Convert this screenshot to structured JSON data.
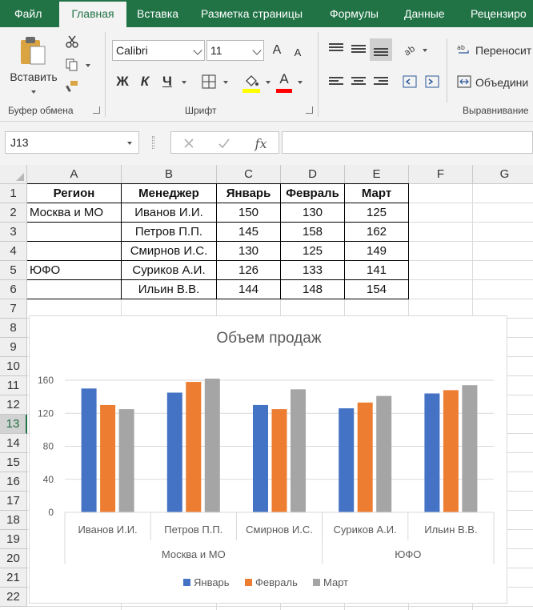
{
  "ribbon": {
    "tabs": [
      "Файл",
      "Главная",
      "Вставка",
      "Разметка страницы",
      "Формулы",
      "Данные",
      "Рецензиро"
    ],
    "active_tab": "Главная",
    "clipboard": {
      "paste_label": "Вставить",
      "group_label": "Буфер обмена"
    },
    "font": {
      "name": "Calibri",
      "size": "11",
      "bold": "Ж",
      "italic": "К",
      "underline": "Ч",
      "grow": "A",
      "shrink": "A",
      "font_color_letter": "A",
      "group_label": "Шрифт"
    },
    "alignment": {
      "wrap_label": "Переносит",
      "merge_label": "Объедини",
      "group_label": "Выравнивание"
    },
    "colors": {
      "fill_color": "#FFFF00",
      "font_color": "#FF0000"
    }
  },
  "formula_bar": {
    "name_box": "J13",
    "fx": "fx",
    "formula": ""
  },
  "sheet": {
    "columns": [
      "A",
      "B",
      "C",
      "D",
      "E",
      "F",
      "G"
    ],
    "rows": [
      "1",
      "2",
      "3",
      "4",
      "5",
      "6",
      "7",
      "8",
      "9",
      "10",
      "11",
      "12",
      "13",
      "14",
      "15",
      "16",
      "17",
      "18",
      "19",
      "20",
      "21",
      "22"
    ],
    "selected_row": "13",
    "header": [
      "Регион",
      "Менеджер",
      "Январь",
      "Февраль",
      "Март"
    ],
    "data": [
      [
        "Москва и МО",
        "Иванов И.И.",
        "150",
        "130",
        "125"
      ],
      [
        "",
        "Петров П.П.",
        "145",
        "158",
        "162"
      ],
      [
        "",
        "Смирнов И.С.",
        "130",
        "125",
        "149"
      ],
      [
        "ЮФО",
        "Суриков А.И.",
        "126",
        "133",
        "141"
      ],
      [
        "",
        "Ильин В.В.",
        "144",
        "148",
        "154"
      ]
    ]
  },
  "chart_data": {
    "type": "bar",
    "title": "Объем продаж",
    "categories": [
      "Иванов И.И.",
      "Петров П.П.",
      "Смирнов И.С.",
      "Суриков А.И.",
      "Ильин В.В."
    ],
    "groups": [
      {
        "label": "Москва и МО",
        "categories": [
          "Иванов И.И.",
          "Петров П.П.",
          "Смирнов И.С."
        ]
      },
      {
        "label": "ЮФО",
        "categories": [
          "Суриков А.И.",
          "Ильин В.В."
        ]
      }
    ],
    "series": [
      {
        "name": "Январь",
        "values": [
          150,
          145,
          130,
          126,
          144
        ],
        "color": "#4472C4"
      },
      {
        "name": "Февраль",
        "values": [
          130,
          158,
          125,
          133,
          148
        ],
        "color": "#ED7D31"
      },
      {
        "name": "Март",
        "values": [
          125,
          162,
          149,
          141,
          154
        ],
        "color": "#A5A5A5"
      }
    ],
    "yticks": [
      "0",
      "40",
      "80",
      "120",
      "160"
    ],
    "ylim": [
      0,
      160
    ],
    "grid": true,
    "legend": "bottom"
  }
}
